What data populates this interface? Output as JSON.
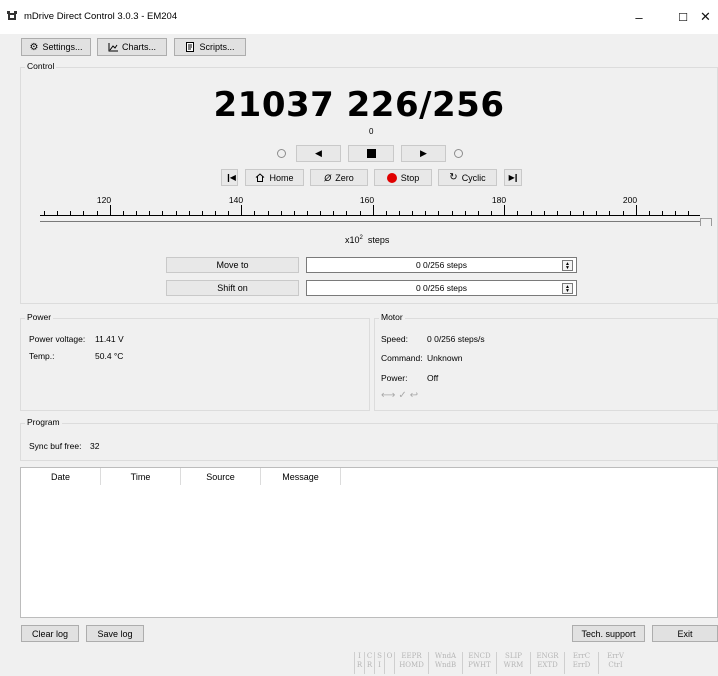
{
  "window": {
    "title": "mDrive Direct Control 3.0.3 - EM204",
    "minimize": "–",
    "maximize": "☐",
    "close": "✕"
  },
  "toolbar": {
    "settings": "Settings...",
    "charts": "Charts...",
    "scripts": "Scripts..."
  },
  "control": {
    "group_title": "Control",
    "position": "21037 226/256",
    "sub_value": "0",
    "home": "Home",
    "zero": "Zero",
    "stop": "Stop",
    "cyclic": "Cyclic",
    "ruler_labels": [
      "120",
      "140",
      "160",
      "180",
      "200"
    ],
    "ruler_unit_base": "x10",
    "ruler_unit_exp": "2",
    "ruler_unit_suffix": "steps",
    "move_to": "Move to",
    "move_to_value": "0 0/256 steps",
    "shift_on": "Shift on",
    "shift_on_value": "0 0/256 steps"
  },
  "power": {
    "group_title": "Power",
    "voltage_label": "Power voltage:",
    "voltage_value": "11.41 V",
    "temp_label": "Temp.:",
    "temp_value": "50.4 °C"
  },
  "motor": {
    "group_title": "Motor",
    "speed_label": "Speed:",
    "speed_value": "0 0/256 steps/s",
    "command_label": "Command:",
    "command_value": "Unknown",
    "power_label": "Power:",
    "power_value": "Off"
  },
  "program": {
    "group_title": "Program",
    "sync_label": "Sync buf free:",
    "sync_value": "32"
  },
  "log": {
    "columns": [
      "Date",
      "Time",
      "Source",
      "Message"
    ]
  },
  "buttons": {
    "clear_log": "Clear log",
    "save_log": "Save log",
    "tech_support": "Tech. support",
    "exit": "Exit"
  },
  "status_flags": {
    "cells": [
      {
        "top": "I",
        "bottom": "R"
      },
      {
        "top": "C",
        "bottom": "R"
      },
      {
        "top": "S",
        "bottom": "I"
      },
      {
        "top": "O",
        "bottom": ""
      },
      {
        "top": "EEPR",
        "bottom": "HOMD"
      },
      {
        "top": "WndA",
        "bottom": "WndB"
      },
      {
        "top": "ENCD",
        "bottom": "PWHT"
      },
      {
        "top": "SLIP",
        "bottom": "WRM"
      },
      {
        "top": "ENGR",
        "bottom": "EXTD"
      },
      {
        "top": "ErrC",
        "bottom": "ErrD"
      },
      {
        "top": "ErrV",
        "bottom": "CtrI"
      }
    ]
  },
  "colors": {
    "background": "#f0f0f0",
    "stop_red": "#e00000",
    "status_grey": "#b5b5b5"
  }
}
